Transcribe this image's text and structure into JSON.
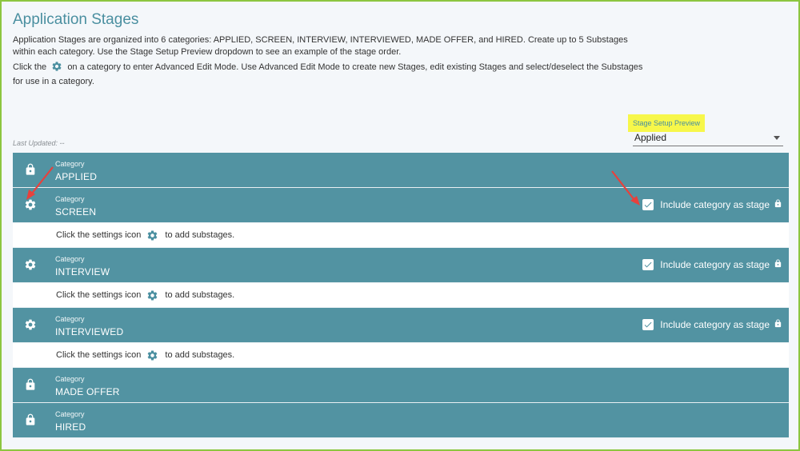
{
  "header": {
    "title": "Application Stages",
    "description_line1": "Application Stages are organized into 6 categories: APPLIED, SCREEN, INTERVIEW, INTERVIEWED, MADE OFFER, and HIRED. Create up to 5 Substages within each category. Use the Stage Setup Preview dropdown to see an example of the stage order.",
    "description_line2_pre": "Click the",
    "description_line2_post": "on a category to enter Advanced Edit Mode. Use Advanced Edit Mode to create new Stages, edit existing Stages and select/deselect the Substages for use in a category."
  },
  "last_updated": "Last Updated: --",
  "preview": {
    "label": "Stage Setup Preview",
    "selected": "Applied"
  },
  "category_label": "Category",
  "include_label": "Include category as stage",
  "substage_hint_pre": "Click the settings icon",
  "substage_hint_post": "to add substages.",
  "stages": [
    {
      "name": "APPLIED",
      "icon": "lock-icon"
    },
    {
      "name": "SCREEN",
      "icon": "gear-icon",
      "include": true
    },
    {
      "name": "INTERVIEW",
      "icon": "gear-icon",
      "include": true
    },
    {
      "name": "INTERVIEWED",
      "icon": "gear-icon",
      "include": true
    },
    {
      "name": "MADE OFFER",
      "icon": "lock-icon"
    },
    {
      "name": "HIRED",
      "icon": "lock-icon"
    }
  ],
  "colors": {
    "bar": "#5293a2",
    "title": "#4a8fa0",
    "highlight": "#f7f74a",
    "arrow": "#e8413c",
    "frame": "#8cc63f"
  }
}
